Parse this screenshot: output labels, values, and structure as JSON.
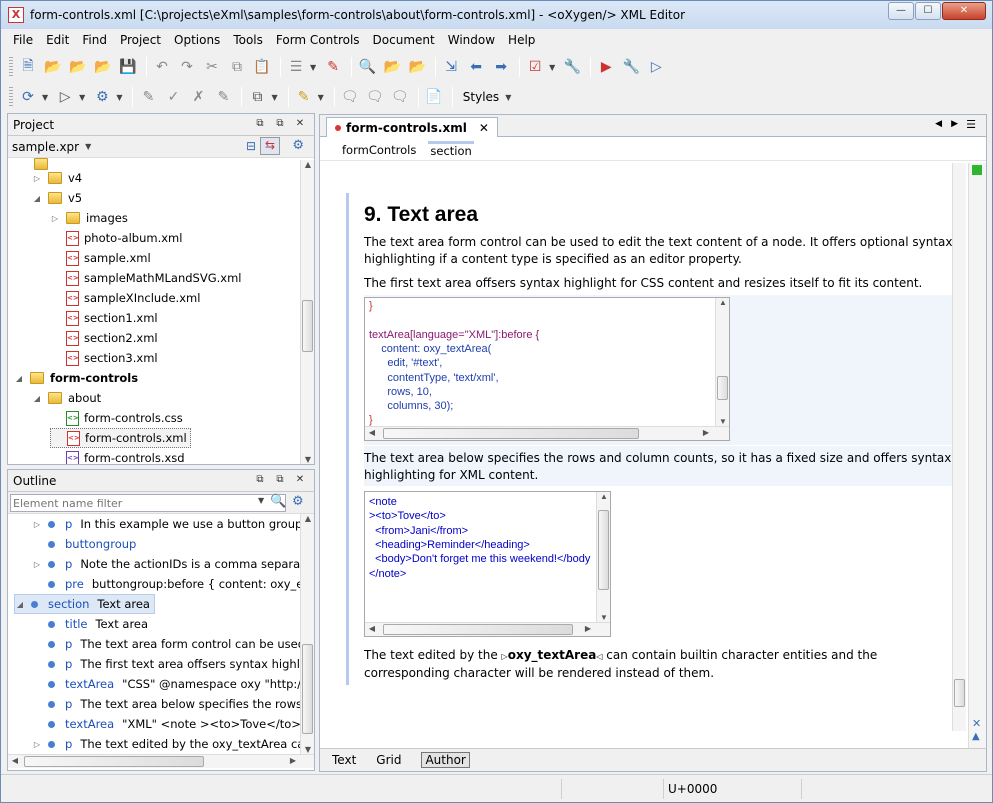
{
  "window": {
    "title": "form-controls.xml [C:\\projects\\eXml\\samples\\form-controls\\about\\form-controls.xml] - <oXygen/> XML Editor"
  },
  "menu": [
    "File",
    "Edit",
    "Find",
    "Project",
    "Options",
    "Tools",
    "Form Controls",
    "Document",
    "Window",
    "Help"
  ],
  "toolbar": {
    "styles_label": "Styles"
  },
  "project": {
    "header": "Project",
    "file": "sample.xpr",
    "tree": [
      {
        "label": "v4",
        "type": "folder",
        "indent": 1,
        "state": "collapsed"
      },
      {
        "label": "v5",
        "type": "folder",
        "indent": 1,
        "state": "expanded"
      },
      {
        "label": "images",
        "type": "folder",
        "indent": 2,
        "state": "collapsed"
      },
      {
        "label": "photo-album.xml",
        "type": "xml",
        "indent": 2
      },
      {
        "label": "sample.xml",
        "type": "xml",
        "indent": 2
      },
      {
        "label": "sampleMathMLandSVG.xml",
        "type": "xml",
        "indent": 2
      },
      {
        "label": "sampleXInclude.xml",
        "type": "xml",
        "indent": 2
      },
      {
        "label": "section1.xml",
        "type": "xml",
        "indent": 2
      },
      {
        "label": "section2.xml",
        "type": "xml",
        "indent": 2
      },
      {
        "label": "section3.xml",
        "type": "xml",
        "indent": 2
      },
      {
        "label": "form-controls",
        "type": "folder",
        "indent": 0,
        "state": "expanded",
        "bold": true
      },
      {
        "label": "about",
        "type": "folder",
        "indent": 1,
        "state": "expanded"
      },
      {
        "label": "form-controls.css",
        "type": "css",
        "indent": 2
      },
      {
        "label": "form-controls.xml",
        "type": "xml",
        "indent": 2,
        "selected": true
      },
      {
        "label": "form-controls.xsd",
        "type": "xsd",
        "indent": 2
      }
    ]
  },
  "outline": {
    "header": "Outline",
    "filter_placeholder": "Element name filter",
    "rows": [
      {
        "tag": "p",
        "text": "In this example we use a button group form",
        "indent": 1,
        "tri": "collapsed"
      },
      {
        "tag": "buttongroup",
        "text": "",
        "indent": 1
      },
      {
        "tag": "p",
        "text": "Note the actionIDs is a comma separated lis",
        "indent": 1,
        "tri": "collapsed"
      },
      {
        "tag": "pre",
        "text": "buttongroup:before { content: oxy_edi",
        "indent": 1
      },
      {
        "tag": "section",
        "text": "Text area",
        "indent": 0,
        "tri": "expanded",
        "selected": true
      },
      {
        "tag": "title",
        "text": "Text area",
        "indent": 1
      },
      {
        "tag": "p",
        "text": "The text area form control can be used to e",
        "indent": 1
      },
      {
        "tag": "p",
        "text": "The first text area offsers syntax highlight",
        "indent": 1
      },
      {
        "tag": "textArea",
        "text": "\"CSS\"  @namespace oxy \"http://www",
        "indent": 1
      },
      {
        "tag": "p",
        "text": "The text area below specifies the rows and",
        "indent": 1
      },
      {
        "tag": "textArea",
        "text": "\"XML\"  <note ><to>Tove</to> <fro",
        "indent": 1
      },
      {
        "tag": "p",
        "text": "The text edited by the oxy_textArea can c",
        "indent": 1,
        "tri": "collapsed"
      }
    ]
  },
  "editor": {
    "tab_label": "form-controls.xml",
    "breadcrumb": [
      "formControls",
      "section"
    ],
    "heading": "9. Text area",
    "p1": "The text area form control can be used to edit the text content of a node. It offers optional syntax highlighting if a content type is specified as an editor property.",
    "p2": "The first text area offsers syntax highlight for CSS content and resizes itself to fit its content.",
    "css_lines": [
      "}",
      "",
      "textArea[language=\"XML\"]:before {",
      "    content: oxy_textArea(",
      "      edit, '#text',",
      "      contentType, 'text/xml',",
      "      rows, 10,",
      "      columns, 30);",
      "}"
    ],
    "p3": "The text area below specifies the rows and column counts, so it has a fixed size and offers syntax highlighting for XML content.",
    "xml_lines": [
      "<note",
      "><to>Tove</to>",
      "  <from>Jani</from>",
      "  <heading>Reminder</heading>",
      "  <body>Don't forget me this weekend!</body",
      "</note>"
    ],
    "p4_before": "The text edited by the",
    "p4_code": "oxy_textArea",
    "p4_after": "can contain builtin character entities and the corresponding character will be rendered instead of them.",
    "bottom_tabs": [
      "Text",
      "Grid",
      "Author"
    ],
    "active_bottom_tab": "Author"
  },
  "status": {
    "unicode": "U+0000"
  }
}
